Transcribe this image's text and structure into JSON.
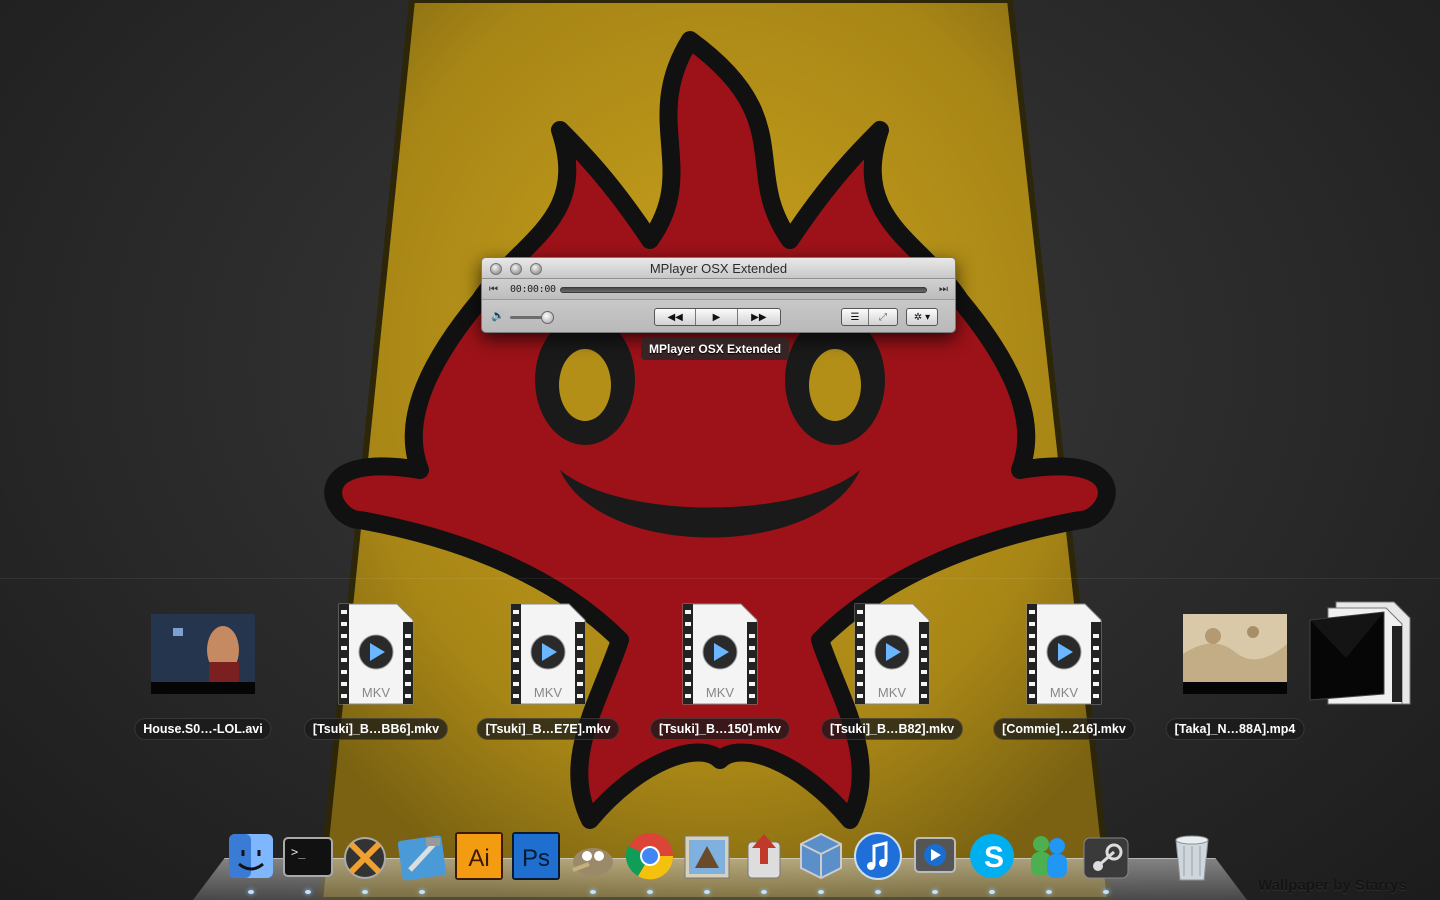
{
  "player": {
    "title": "MPlayer OSX Extended",
    "time": "00:00:00",
    "progress": 0,
    "volume": 0.75,
    "transport": [
      "◀◀",
      "▶",
      "▶▶"
    ],
    "view_buttons": [
      "☰",
      "⤢"
    ],
    "action_menu": "✲ ▾"
  },
  "tooltip": "MPlayer OSX Extended",
  "stack": {
    "files": [
      {
        "name": "House.S0…-LOL.avi",
        "kind": "video-thumb"
      },
      {
        "name": "[Tsuki]_B…BB6].mkv",
        "kind": "mkv",
        "badge": "MKV"
      },
      {
        "name": "[Tsuki]_B…E7E].mkv",
        "kind": "mkv",
        "badge": "MKV"
      },
      {
        "name": "[Tsuki]_B…150].mkv",
        "kind": "mkv",
        "badge": "MKV"
      },
      {
        "name": "[Tsuki]_B…B82].mkv",
        "kind": "mkv",
        "badge": "MKV"
      },
      {
        "name": "[Commie]…216].mkv",
        "kind": "mkv",
        "badge": "MKV"
      },
      {
        "name": "[Taka]_N…88A].mp4",
        "kind": "image-thumb"
      }
    ]
  },
  "dock": {
    "apps": [
      {
        "name": "Finder",
        "icon": "finder-icon",
        "running": true
      },
      {
        "name": "Terminal",
        "icon": "terminal-icon",
        "running": true
      },
      {
        "name": "X11",
        "icon": "x11-icon",
        "running": true
      },
      {
        "name": "Xcode",
        "icon": "xcode-icon",
        "running": true
      },
      {
        "name": "Illustrator",
        "icon": "illustrator-icon",
        "label": "Ai",
        "running": false
      },
      {
        "name": "Photoshop",
        "icon": "photoshop-icon",
        "label": "Ps",
        "running": false
      },
      {
        "name": "GIMP",
        "icon": "gimp-icon",
        "running": true
      },
      {
        "name": "Chrome",
        "icon": "chrome-icon",
        "running": true
      },
      {
        "name": "Mail",
        "icon": "mail-icon",
        "running": true
      },
      {
        "name": "Transmission",
        "icon": "transmission-icon",
        "running": true
      },
      {
        "name": "VirtualBox",
        "icon": "virtualbox-icon",
        "running": true
      },
      {
        "name": "iTunes",
        "icon": "itunes-icon",
        "running": true
      },
      {
        "name": "MPlayer OSX Extended",
        "icon": "mplayer-icon",
        "running": true
      },
      {
        "name": "Skype",
        "icon": "skype-icon",
        "running": true
      },
      {
        "name": "Messenger",
        "icon": "messenger-icon",
        "running": true
      },
      {
        "name": "Steam",
        "icon": "steam-icon",
        "running": true
      },
      {
        "name": "Trash",
        "icon": "trash-icon",
        "running": false
      }
    ]
  },
  "credit": "Wallpaper by Starrys",
  "colors": {
    "wallpaper_bg": "#2a2a2a",
    "board_yellow": "#b8961a",
    "flame_red": "#a0141c",
    "flame_outline": "#141414"
  }
}
